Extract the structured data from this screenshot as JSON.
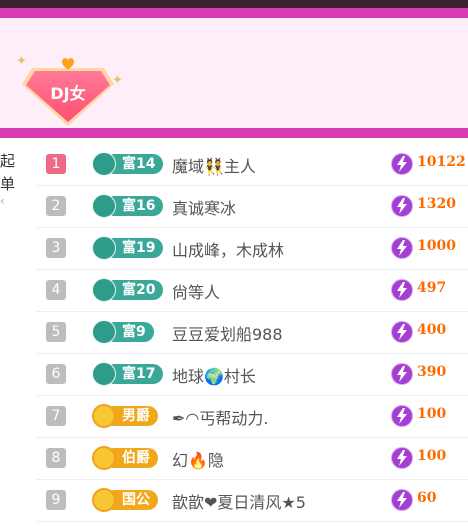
{
  "banner": {
    "badge_label": "DJ女"
  },
  "side_tab": {
    "chars": [
      "起",
      "单"
    ]
  },
  "colors": {
    "accent": "#d63bb3",
    "value": "#ff6a00",
    "rank_top": "#f06a86",
    "wealth_badge": "#3aa898",
    "noble_badge": "#f0a81a"
  },
  "rows": [
    {
      "rank": "1",
      "badge_type": "wealth",
      "badge_label": "富14",
      "name": "魔域👯主人",
      "value": "10122"
    },
    {
      "rank": "2",
      "badge_type": "wealth",
      "badge_label": "富16",
      "name": "真诚寒冰",
      "value": "1320"
    },
    {
      "rank": "3",
      "badge_type": "wealth",
      "badge_label": "富19",
      "name": "山成峰，木成林",
      "value": "1000"
    },
    {
      "rank": "4",
      "badge_type": "wealth",
      "badge_label": "富20",
      "name": "尙等人",
      "value": "497"
    },
    {
      "rank": "5",
      "badge_type": "wealth",
      "badge_label": "富9",
      "name": "豆豆爱划船988",
      "value": "400"
    },
    {
      "rank": "6",
      "badge_type": "wealth",
      "badge_label": "富17",
      "name": "地球🌍村长",
      "value": "390"
    },
    {
      "rank": "7",
      "badge_type": "noble",
      "badge_label": "男爵",
      "name": "✒◠丐帮动力.",
      "value": "100"
    },
    {
      "rank": "8",
      "badge_type": "noble",
      "badge_label": "伯爵",
      "name": "幻🔥隐",
      "value": "100"
    },
    {
      "rank": "9",
      "badge_type": "noble",
      "badge_label": "国公",
      "name": "歆歆❤夏日清风★5",
      "value": "60"
    }
  ],
  "icons": {
    "level_badge": "level-badge-icon",
    "currency": "lightning-currency-icon"
  }
}
